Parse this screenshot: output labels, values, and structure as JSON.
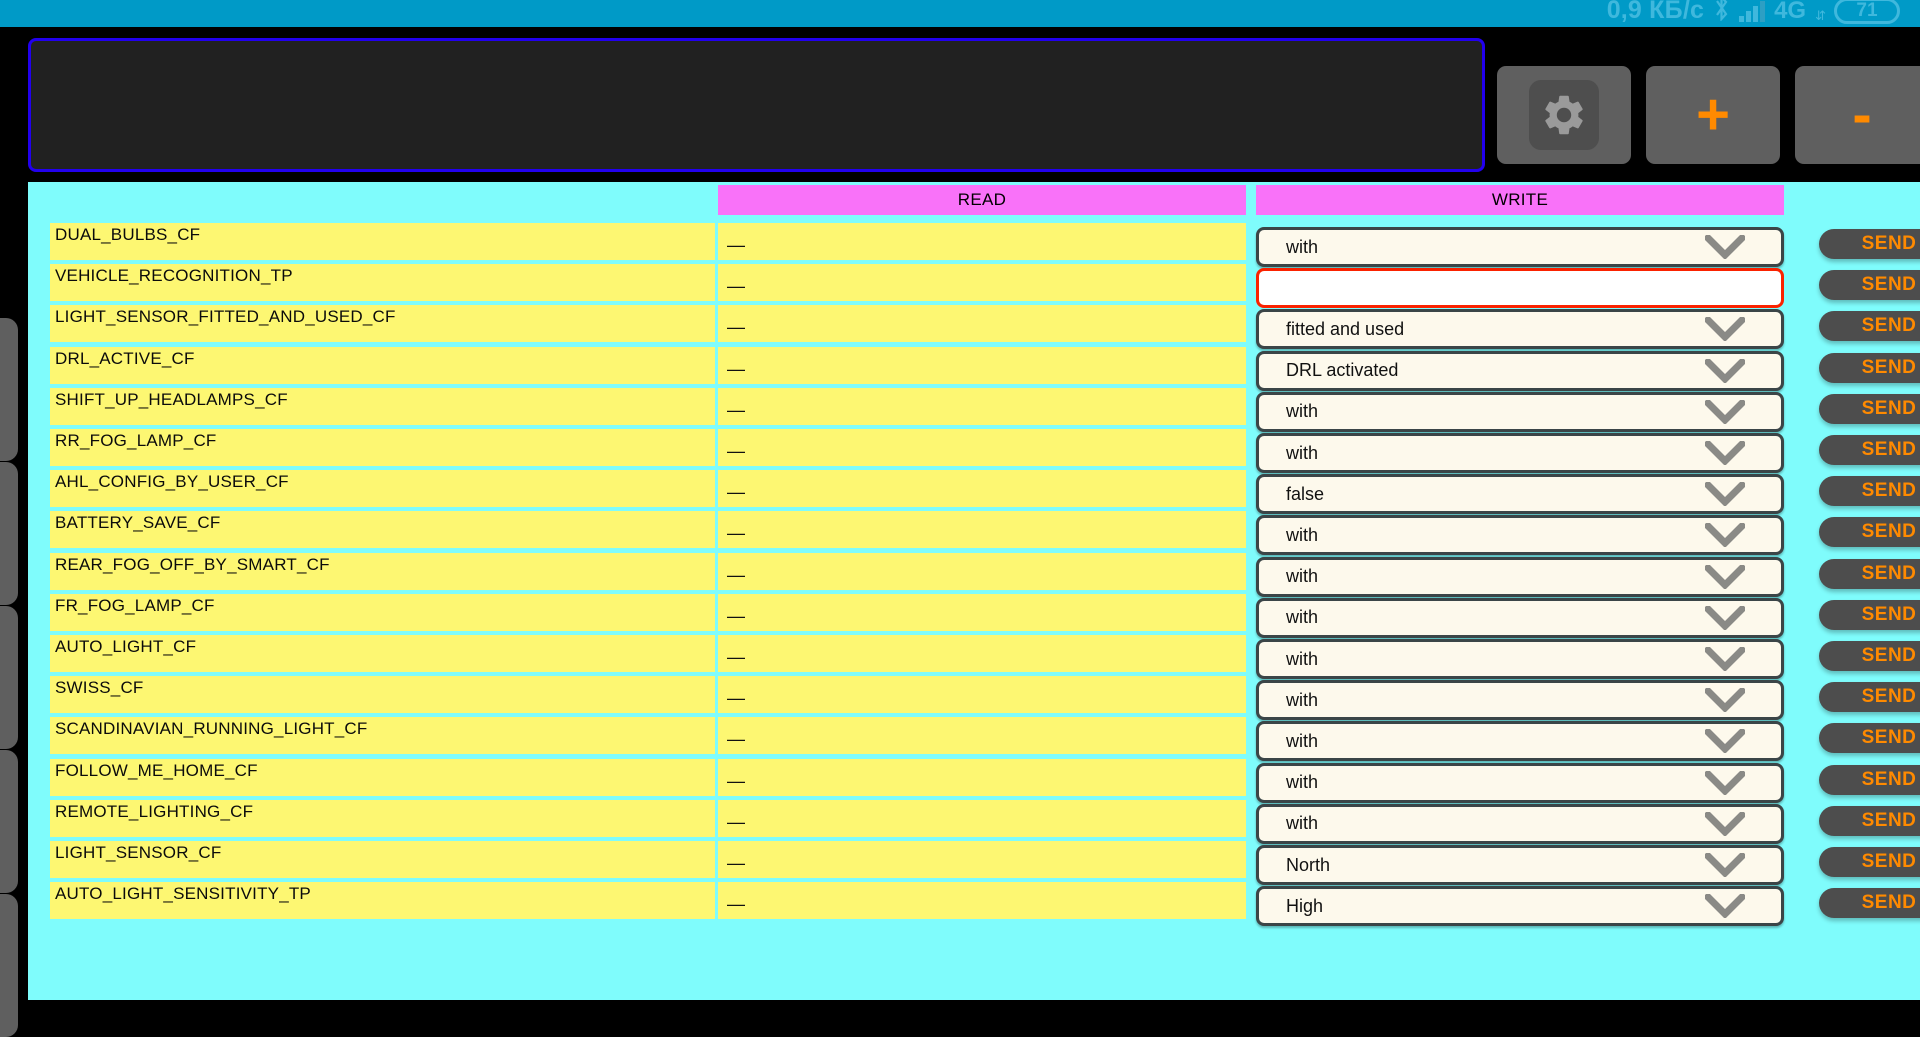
{
  "status_bar": {
    "data_rate": "0,9 КБ/с",
    "bluetooth_icon": "bluetooth-icon",
    "signal_icon": "signal-bars-icon",
    "network": "4G",
    "data_arrows": "⇵",
    "battery_percent": "71",
    "background_color": "#009ac7"
  },
  "toolbar": {
    "console_text": "",
    "gear_button_label": "gear-button",
    "plus_button_label": "+",
    "minus_button_label": "-",
    "accent_color": "#ff8a00",
    "console_border_color": "#2200ee"
  },
  "table": {
    "headers": {
      "name": "",
      "read": "READ",
      "write": "WRITE"
    },
    "send_label": "SEND",
    "read_placeholder": "—",
    "rows": [
      {
        "name": "DUAL_BULBS_CF",
        "read": "—",
        "write_type": "dropdown",
        "write": "with"
      },
      {
        "name": "VEHICLE_RECOGNITION_TP",
        "read": "—",
        "write_type": "textbox",
        "write": ""
      },
      {
        "name": "LIGHT_SENSOR_FITTED_AND_USED_CF",
        "read": "—",
        "write_type": "dropdown",
        "write": "fitted and used"
      },
      {
        "name": "DRL_ACTIVE_CF",
        "read": "—",
        "write_type": "dropdown",
        "write": "DRL activated"
      },
      {
        "name": "SHIFT_UP_HEADLAMPS_CF",
        "read": "—",
        "write_type": "dropdown",
        "write": "with"
      },
      {
        "name": "RR_FOG_LAMP_CF",
        "read": "—",
        "write_type": "dropdown",
        "write": "with"
      },
      {
        "name": "AHL_CONFIG_BY_USER_CF",
        "read": "—",
        "write_type": "dropdown",
        "write": "false"
      },
      {
        "name": "BATTERY_SAVE_CF",
        "read": "—",
        "write_type": "dropdown",
        "write": "with"
      },
      {
        "name": "REAR_FOG_OFF_BY_SMART_CF",
        "read": "—",
        "write_type": "dropdown",
        "write": "with"
      },
      {
        "name": "FR_FOG_LAMP_CF",
        "read": "—",
        "write_type": "dropdown",
        "write": "with"
      },
      {
        "name": "AUTO_LIGHT_CF",
        "read": "—",
        "write_type": "dropdown",
        "write": "with"
      },
      {
        "name": "SWISS_CF",
        "read": "—",
        "write_type": "dropdown",
        "write": "with"
      },
      {
        "name": "SCANDINAVIAN_RUNNING_LIGHT_CF",
        "read": "—",
        "write_type": "dropdown",
        "write": "with"
      },
      {
        "name": "FOLLOW_ME_HOME_CF",
        "read": "—",
        "write_type": "dropdown",
        "write": "with"
      },
      {
        "name": "REMOTE_LIGHTING_CF",
        "read": "—",
        "write_type": "dropdown",
        "write": "with"
      },
      {
        "name": "LIGHT_SENSOR_CF",
        "read": "—",
        "write_type": "dropdown",
        "write": "North"
      },
      {
        "name": "AUTO_LIGHT_SENSITIVITY_TP",
        "read": "—",
        "write_type": "dropdown",
        "write": "High"
      }
    ]
  },
  "colors": {
    "panel_bg": "#7ffcfc",
    "cell_bg": "#fdf772",
    "header_bg": "#f972f9",
    "dropdown_bg": "#fdf9ec",
    "send_bg": "#4d4d4d",
    "error_border": "#fa2200"
  }
}
